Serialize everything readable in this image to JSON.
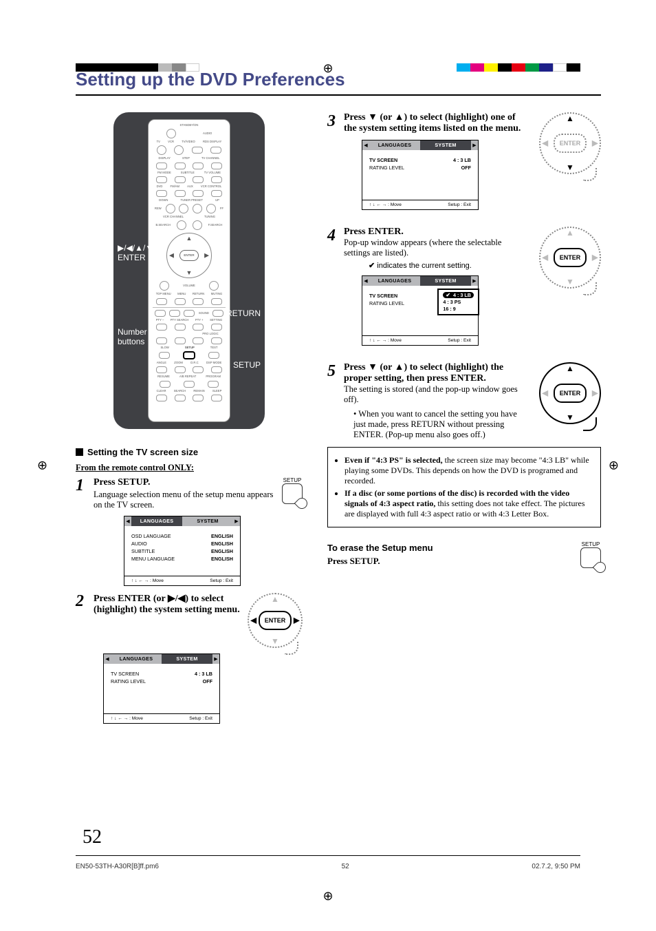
{
  "page_title": "Setting up the DVD Preferences",
  "page_number": "52",
  "remote_callouts": {
    "nav_enter": "▶/◀/▲/▼\nENTER",
    "number": "Number\nbuttons",
    "return": "RETURN",
    "setup": "SETUP"
  },
  "remote_labels": {
    "standby": "STANDBY/ON",
    "audio": "AUDIO",
    "tv": "TV",
    "vcr": "VCR",
    "tvvideo": "TV/VIDEO",
    "rds": "RDS DISPLAY",
    "display": "DISPLAY",
    "step": "STEP",
    "tvch": "TV CHANNEL",
    "fmmode": "FM MODE",
    "subtitle": "SUBTITLE",
    "tvvol": "TV VOLUME",
    "dvd": "DVD",
    "fmam": "FM/AM",
    "aux": "AUX",
    "vcrctrl": "VCR CONTROL",
    "tuner": "TUNER PRESET",
    "down": "DOWN",
    "up": "UP",
    "rew": "REW",
    "ff": "FF",
    "vcrch": "VCR CHANNEL",
    "tuning": "TUNING",
    "bsearch": "B.SEARCH",
    "fsearch": "F.SEARCH",
    "enter": "ENTER",
    "volume": "VOLUME",
    "topmenu": "TOP MENU",
    "menu": "MENU",
    "return_btn": "RETURN",
    "muting": "MUTING",
    "sound": "SOUND",
    "pty_minus": "PTY –",
    "ptysearch": "PTY SEARCH",
    "pty_plus": "PTY +",
    "setting": "SETTING",
    "prologic": "PRO LOGIC",
    "slow": "SLOW",
    "setup_btn": "SETUP",
    "test": "TEST",
    "angle": "ANGLE",
    "zoom": "ZOOM",
    "drc": "D.R.C",
    "dspmode": "DSP MODE",
    "resume": "RESUME",
    "abrepeat": "A/B REPEAT",
    "program": "PROGRAM",
    "clear": "CLEAR",
    "search": "SEARCH",
    "remain": "REMAIN",
    "sleep": "SLEEP"
  },
  "tv_section_heading": "Setting the TV screen size",
  "remote_only": "From the remote control ONLY:",
  "steps": {
    "s1": {
      "num": "1",
      "lead": "Press SETUP.",
      "body": "Language selection menu of the setup menu appears on the TV screen.",
      "icon_label": "SETUP"
    },
    "s2": {
      "num": "2",
      "lead": "Press ENTER (or ▶/◀) to select (highlight) the system setting menu.",
      "enter": "ENTER"
    },
    "s3": {
      "num": "3",
      "lead": "Press ▼ (or ▲) to select (highlight) one of the system setting items listed on the menu.",
      "enter": "ENTER"
    },
    "s4": {
      "num": "4",
      "lead": "Press ENTER.",
      "body": "Pop-up window appears (where the selectable settings are listed).",
      "caption_pre": "indicates the current setting.",
      "enter": "ENTER"
    },
    "s5": {
      "num": "5",
      "lead": "Press ▼ (or ▲) to select (highlight) the proper setting, then press ENTER.",
      "body": "The setting is stored (and the pop-up window goes off).",
      "bullet": "When you want to cancel the setting you have just made, press RETURN without pressing ENTER. (Pop-up menu also goes off.)",
      "enter": "ENTER"
    }
  },
  "osd": {
    "tab_lang": "LANGUAGES",
    "tab_sys": "SYSTEM",
    "foot_move": "↑ ↓ ← → : Move",
    "foot_exit": "Setup : Exit",
    "lang_rows": [
      {
        "lbl": "OSD LANGUAGE",
        "val": "ENGLISH"
      },
      {
        "lbl": "AUDIO",
        "val": "ENGLISH"
      },
      {
        "lbl": "SUBTITLE",
        "val": "ENGLISH"
      },
      {
        "lbl": "MENU LANGUAGE",
        "val": "ENGLISH"
      }
    ],
    "sys_rows": [
      {
        "lbl": "TV SCREEN",
        "val": "4 : 3 LB"
      },
      {
        "lbl": "RATING LEVEL",
        "val": "OFF"
      }
    ],
    "sys_rows_hi": [
      {
        "lbl": "TV SCREEN",
        "val": "4 : 3 LB",
        "hi": true
      },
      {
        "lbl": "RATING LEVEL",
        "val": "OFF"
      }
    ],
    "popup_opts": [
      "4 : 3 LB",
      "4 : 3 PS",
      "16 : 9"
    ]
  },
  "note_box": {
    "li1_b": "Even if \"4:3 PS\" is selected,",
    "li1_r": " the screen size may become \"4:3 LB\" while playing some DVDs. This depends on how the DVD is programed and recorded.",
    "li2_b": "If a disc (or some portions of the disc) is recorded with the video signals of 4:3 aspect ratio,",
    "li2_r": " this setting does not take effect. The pictures are displayed with full 4:3 aspect ratio or with 4:3 Letter Box."
  },
  "erase": {
    "heading": "To erase the Setup menu",
    "body": "Press SETUP.",
    "icon_label": "SETUP"
  },
  "footer": {
    "left": "EN50-53TH-A30R[B]ff.pm6",
    "center": "52",
    "right": "02.7.2, 9:50 PM"
  },
  "registration_colors_left": [
    "#000",
    "#000",
    "#000",
    "#000",
    "#000",
    "#000",
    "#bbb",
    "#888",
    "#fff"
  ],
  "registration_colors_right": [
    "#00AEEF",
    "#E4007F",
    "#FFF100",
    "#000",
    "#E60012",
    "#009944",
    "#1D2088",
    "#fff",
    "#000"
  ]
}
